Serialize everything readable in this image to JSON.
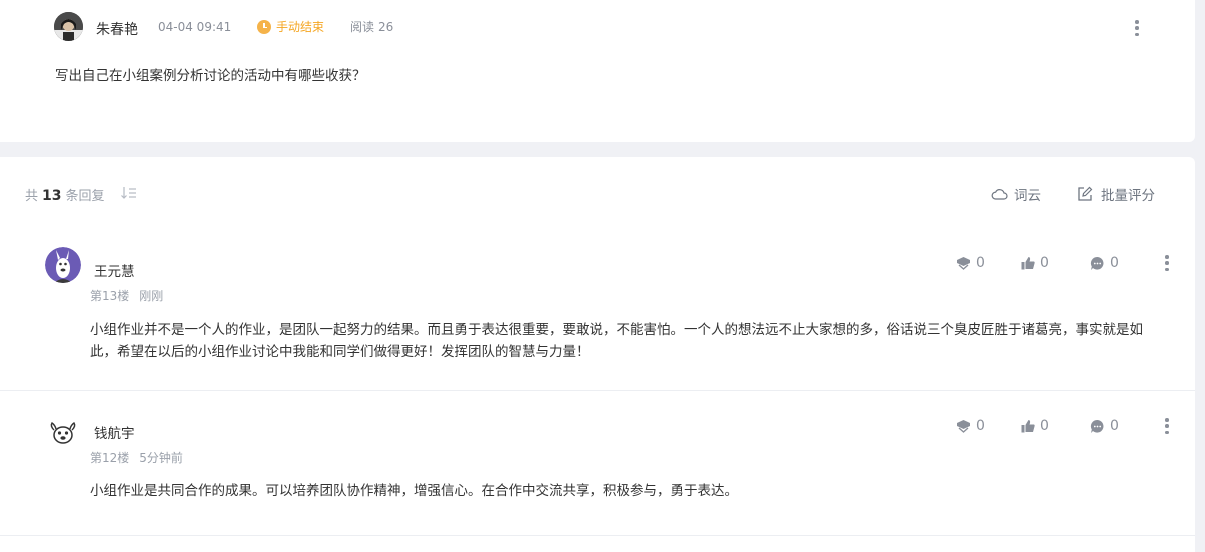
{
  "topic": {
    "author": "朱春艳",
    "time": "04-04 09:41",
    "status": "手动结束",
    "reads_label": "阅读",
    "reads_count": "26",
    "question": "写出自己在小组案例分析讨论的活动中有哪些收获？"
  },
  "replies_header": {
    "prefix": "共",
    "count": "13",
    "suffix": "条回复",
    "wordcloud_label": "词云",
    "batch_score_label": "批量评分"
  },
  "replies": [
    {
      "name": "王元慧",
      "floor": "第13楼",
      "time": "刚刚",
      "content": "小组作业并不是一个人的作业，是团队一起努力的结果。而且勇于表达很重要，要敢说，不能害怕。一个人的想法远不止大家想的多，俗话说三个臭皮匠胜于诸葛亮，事实就是如此，希望在以后的小组作业讨论中我能和同学们做得更好！发挥团队的智慧与力量！",
      "awards": "0",
      "likes": "0",
      "comments": "0"
    },
    {
      "name": "钱航宇",
      "floor": "第12楼",
      "time": "5分钟前",
      "content": "小组作业是共同合作的成果。可以培养团队协作精神，增强信心。在合作中交流共享，积极参与，勇于表达。",
      "awards": "0",
      "likes": "0",
      "comments": "0"
    }
  ],
  "colors": {
    "page_bg": "#f0f1f5",
    "status_orange": "#f5a623",
    "muted_text": "#8a8f99",
    "avatar_purple": "#6b5bb5"
  }
}
